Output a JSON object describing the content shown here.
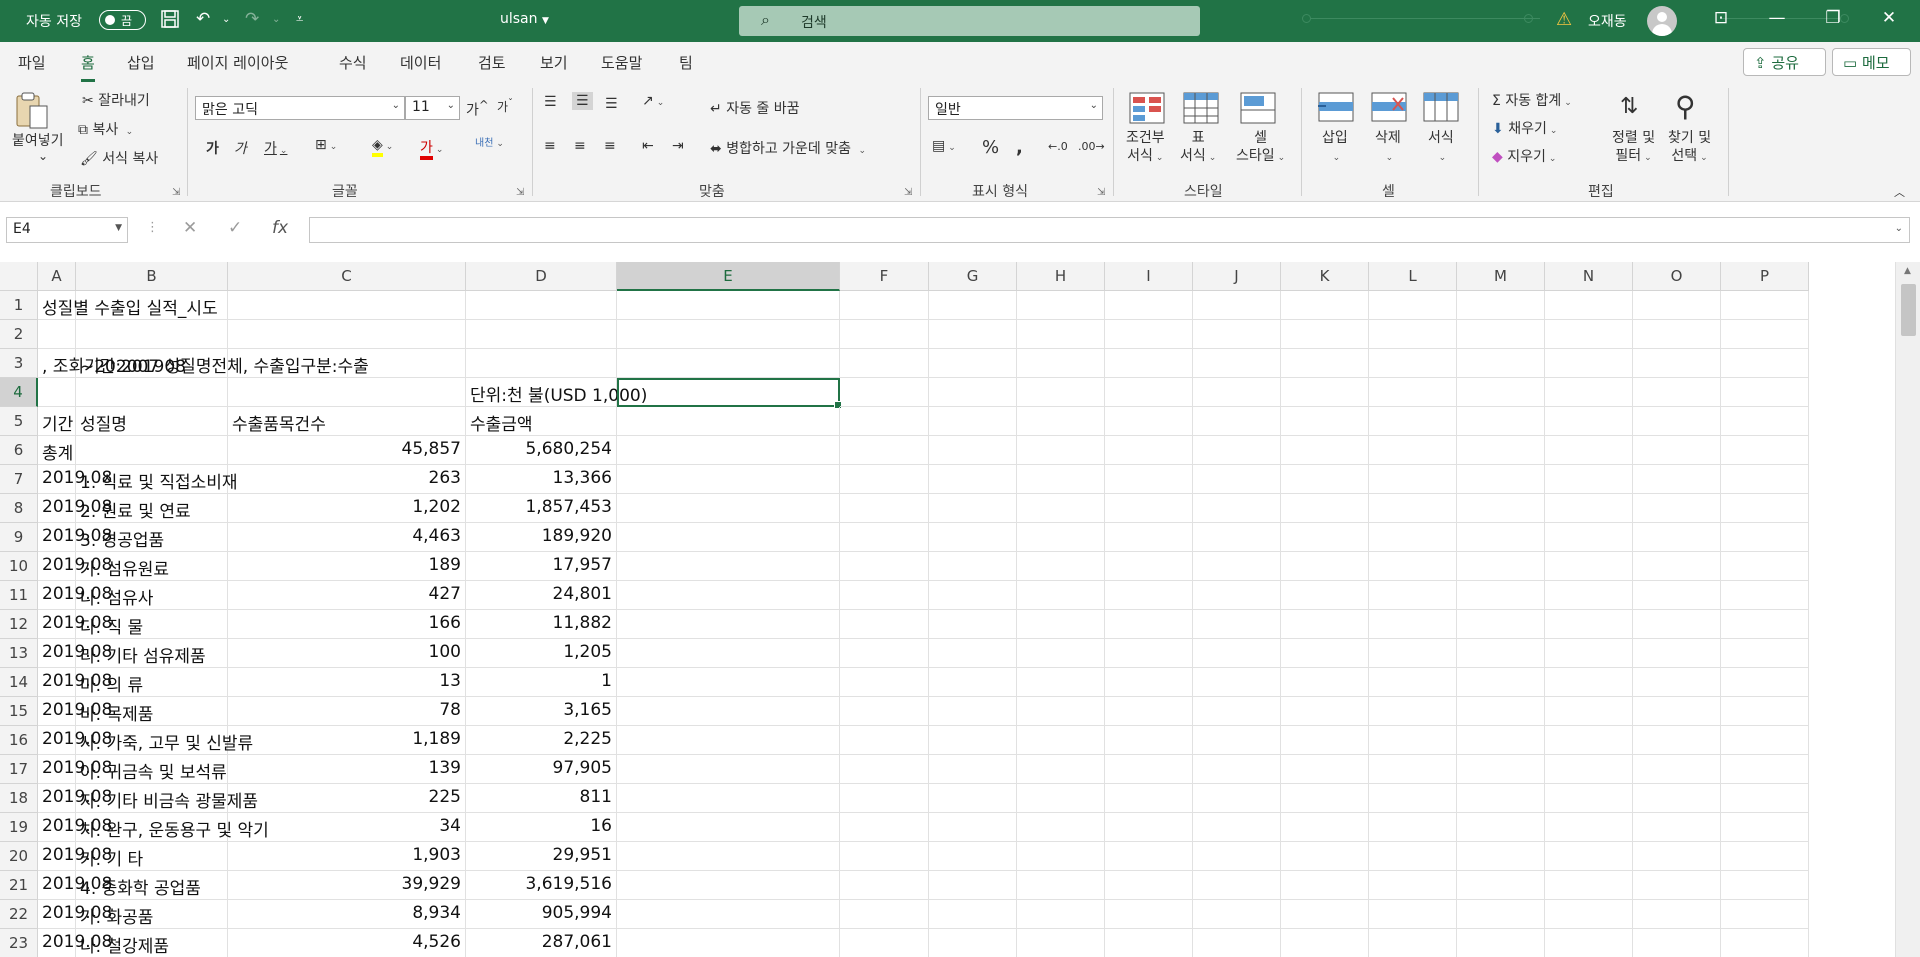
{
  "titlebar": {
    "autosave_label": "자동 저장",
    "autosave_toggle": "끔",
    "document_name": "ulsan",
    "search_placeholder": "검색",
    "user_name": "오재동"
  },
  "ribbon_tabs": [
    "파일",
    "홈",
    "삽입",
    "페이지 레이아웃",
    "수식",
    "데이터",
    "검토",
    "보기",
    "도움말",
    "팀"
  ],
  "active_tab": "홈",
  "ribbon_right": {
    "share": "공유",
    "comments": "메모"
  },
  "ribbon": {
    "clipboard": {
      "paste": "붙여넣기",
      "cut": "잘라내기",
      "copy": "복사",
      "format_painter": "서식 복사",
      "group": "클립보드"
    },
    "font": {
      "name": "맑은 고딕",
      "size": "11",
      "bold": "가",
      "italic": "가",
      "underline": "가",
      "font_color": "가",
      "phonetic": "내천",
      "grow": "가",
      "shrink": "가",
      "group": "글꼴"
    },
    "alignment": {
      "wrap": "자동 줄 바꿈",
      "merge": "병합하고 가운데 맞춤",
      "group": "맞춤"
    },
    "number": {
      "format": "일반",
      "group": "표시 형식"
    },
    "styles": {
      "conditional": [
        "조건부",
        "서식"
      ],
      "table": [
        "표",
        "서식"
      ],
      "cell": [
        "셀",
        "스타일"
      ],
      "group": "스타일"
    },
    "cells": {
      "insert": "삽입",
      "delete": "삭제",
      "format": "서식",
      "group": "셀"
    },
    "editing": {
      "autosum": "자동 합계",
      "fill": "채우기",
      "clear": "지우기",
      "sort": [
        "정렬 및",
        "필터"
      ],
      "find": [
        "찾기 및",
        "선택"
      ],
      "group": "편집"
    }
  },
  "formula_bar": {
    "name_box": "E4",
    "formula": ""
  },
  "columns": [
    "A",
    "B",
    "C",
    "D",
    "E",
    "F",
    "G",
    "H",
    "I",
    "J",
    "K",
    "L",
    "M",
    "N",
    "O",
    "P"
  ],
  "selected_cell": "E4",
  "rows": [
    {
      "n": "1",
      "a": "성질별 수출입 실적_시도",
      "b": "",
      "c": "",
      "d": ""
    },
    {
      "n": "2",
      "a": "",
      "b": "",
      "c": "",
      "d": ""
    },
    {
      "n": "3",
      "a": ", 조회기간:201908",
      "b": "~202007 성질명전체, 수출입구분:수출",
      "c": "",
      "d": ""
    },
    {
      "n": "4",
      "a": "",
      "b": "",
      "c": "",
      "d": "단위:천 불(USD 1,000)"
    },
    {
      "n": "5",
      "a": "기간",
      "b": "성질명",
      "c": "수출품목건수",
      "d": "수출금액"
    },
    {
      "n": "6",
      "a": "총계",
      "b": "",
      "c": "45,857",
      "d": "5,680,254"
    },
    {
      "n": "7",
      "a": "2019.08",
      "b": "1. 식료 및 직접소비재",
      "c": "263",
      "d": "13,366"
    },
    {
      "n": "8",
      "a": "2019.08",
      "b": "2. 원료 및 연료",
      "c": "1,202",
      "d": "1,857,453"
    },
    {
      "n": "9",
      "a": "2019.08",
      "b": "3. 경공업품",
      "c": "4,463",
      "d": "189,920"
    },
    {
      "n": "10",
      "a": "2019.08",
      "b": "가. 섬유원료",
      "c": "189",
      "d": "17,957"
    },
    {
      "n": "11",
      "a": "2019.08",
      "b": "나. 섬유사",
      "c": "427",
      "d": "24,801"
    },
    {
      "n": "12",
      "a": "2019.08",
      "b": "다. 직 물",
      "c": "166",
      "d": "11,882"
    },
    {
      "n": "13",
      "a": "2019.08",
      "b": "라. 기타 섬유제품",
      "c": "100",
      "d": "1,205"
    },
    {
      "n": "14",
      "a": "2019.08",
      "b": "마. 의 류",
      "c": "13",
      "d": "1"
    },
    {
      "n": "15",
      "a": "2019.08",
      "b": "바. 목제품",
      "c": "78",
      "d": "3,165"
    },
    {
      "n": "16",
      "a": "2019.08",
      "b": "사. 가죽, 고무 및 신발류",
      "c": "1,189",
      "d": "2,225"
    },
    {
      "n": "17",
      "a": "2019.08",
      "b": "아. 귀금속 및 보석류",
      "c": "139",
      "d": "97,905"
    },
    {
      "n": "18",
      "a": "2019.08",
      "b": "자. 기타 비금속 광물제품",
      "c": "225",
      "d": "811"
    },
    {
      "n": "19",
      "a": "2019.08",
      "b": "차. 완구, 운동용구 및 악기",
      "c": "34",
      "d": "16"
    },
    {
      "n": "20",
      "a": "2019.08",
      "b": "카. 기 타",
      "c": "1,903",
      "d": "29,951"
    },
    {
      "n": "21",
      "a": "2019.08",
      "b": "4. 중화학 공업품",
      "c": "39,929",
      "d": "3,619,516"
    },
    {
      "n": "22",
      "a": "2019.08",
      "b": "가. 화공품",
      "c": "8,934",
      "d": "905,994"
    },
    {
      "n": "23",
      "a": "2019.08",
      "b": "나. 철강제품",
      "c": "4,526",
      "d": "287,061"
    }
  ]
}
